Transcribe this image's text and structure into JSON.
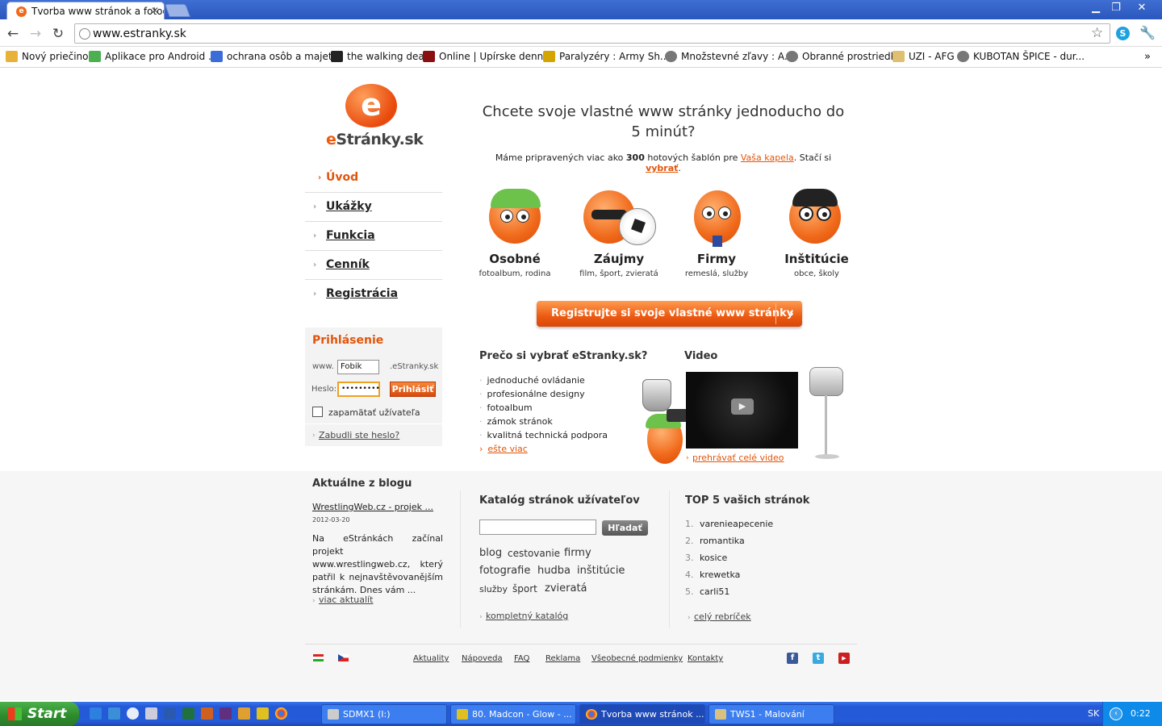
{
  "browser": {
    "tab_title": "Tvorba www stránok a fotogal",
    "url": "www.estranky.sk",
    "bookmarks": [
      {
        "label": "Nový priečinok",
        "color": "#e8b23a"
      },
      {
        "label": "Aplikace pro Android ...",
        "color": "#4caf50"
      },
      {
        "label": "ochrana osôb a majet...",
        "color": "#3b6dd8"
      },
      {
        "label": "the walking dead",
        "color": "#222222"
      },
      {
        "label": "Online | Upírske denní...",
        "color": "#8a1010"
      },
      {
        "label": "Paralyzéry : Army Sh...",
        "color": "#d4a400"
      },
      {
        "label": "Množstevné zľavy : A...",
        "color": "#777777"
      },
      {
        "label": "Obranné prostriedky",
        "color": "#777777"
      },
      {
        "label": "UZI - AFG",
        "color": "#e0c070"
      },
      {
        "label": "KUBOTAN ŠPICE - dur...",
        "color": "#777777"
      }
    ]
  },
  "logo": {
    "e": "e",
    "prefix": "e",
    "main": "Stránky",
    "suffix": ".sk"
  },
  "menu": [
    {
      "label": "Úvod",
      "active": true
    },
    {
      "label": "Ukážky"
    },
    {
      "label": "Funkcia"
    },
    {
      "label": "Cenník"
    },
    {
      "label": "Registrácia"
    }
  ],
  "login": {
    "title": "Prihlásenie",
    "www_label": "www.",
    "username": "Fobik",
    "domain_suffix": ".eStranky.sk",
    "password_label": "Heslo:",
    "password": "•••••••••",
    "submit": "Prihlásiť",
    "remember": "zapamätať užívateľa",
    "forgot": "Zabudli ste heslo?"
  },
  "hero": {
    "headline": "Chcete svoje vlastné www stránky jednoducho do 5 minút?",
    "sub_before": "Máme pripravených viac ako ",
    "sub_count": "300",
    "sub_middle": " hotových šablón pre ",
    "sub_link": "Vaša kapela",
    "sub_after": ". Stačí si ",
    "sub_choose": "vybrať",
    "sub_end": "."
  },
  "categories": [
    {
      "title": "Osobné",
      "sub": "fotoalbum, rodina"
    },
    {
      "title": "Záujmy",
      "sub": "film, šport, zvieratá"
    },
    {
      "title": "Firmy",
      "sub": "remeslá, služby"
    },
    {
      "title": "Inštitúcie",
      "sub": "obce, školy"
    }
  ],
  "register_button": "Registrujte si svoje vlastné www stránky",
  "why": {
    "title": "Prečo si vybrať eStranky.sk?",
    "items": [
      "jednoduché ovládanie",
      "profesionálne designy",
      "fotoalbum",
      "zámok stránok",
      "kvalitná technická podpora"
    ],
    "more": "ešte viac"
  },
  "video": {
    "title": "Video",
    "play_link": "prehrávať celé video"
  },
  "blog": {
    "title": "Aktuálne z blogu",
    "post_title": "WrestlingWeb.cz - projek ...",
    "post_date": "2012-03-20",
    "post_text": "Na eStránkách začínal projekt www.wrestlingweb.cz, který patřil k nejnavštěvovanějším stránkám. Dnes vám ...",
    "more": "viac aktualít"
  },
  "catalog": {
    "title": "Katalóg stránok užívateľov",
    "search_button": "Hľadať",
    "tags_row1": [
      "blog",
      "cestovanie",
      "firmy"
    ],
    "tags_row2": [
      "fotografie",
      "hudba",
      "inštitúcie"
    ],
    "tags_row3": [
      "služby",
      "šport",
      "zvieratá"
    ],
    "full": "kompletný katalóg"
  },
  "top5": {
    "title": "TOP 5 vašich stránok",
    "items": [
      {
        "n": "1.",
        "name": "varenieapecenie"
      },
      {
        "n": "2.",
        "name": "romantika"
      },
      {
        "n": "3.",
        "name": "kosice"
      },
      {
        "n": "4.",
        "name": "krewetka"
      },
      {
        "n": "5.",
        "name": "carli51"
      }
    ],
    "all": "celý rebríček"
  },
  "footer": {
    "links": [
      "Aktuality",
      "Nápoveda",
      "FAQ",
      "Reklama",
      "Všeobecné podmienky",
      "Kontakty"
    ],
    "social": [
      {
        "icon": "facebook-icon",
        "t": "f",
        "color": "#3b5998"
      },
      {
        "icon": "twitter-icon",
        "t": "t",
        "color": "#3aa9e0"
      },
      {
        "icon": "youtube-icon",
        "t": "▶",
        "color": "#cc1f1f"
      }
    ]
  },
  "taskbar": {
    "start": "Start",
    "tasks": [
      {
        "label": "SDMX1 (I:)",
        "active": false
      },
      {
        "label": "80. Madcon - Glow - ...",
        "active": false
      },
      {
        "label": "Tvorba www stránok ...",
        "active": true
      },
      {
        "label": "TWS1 - Malování",
        "active": false
      }
    ],
    "lang": "SK",
    "clock": "0:22"
  }
}
